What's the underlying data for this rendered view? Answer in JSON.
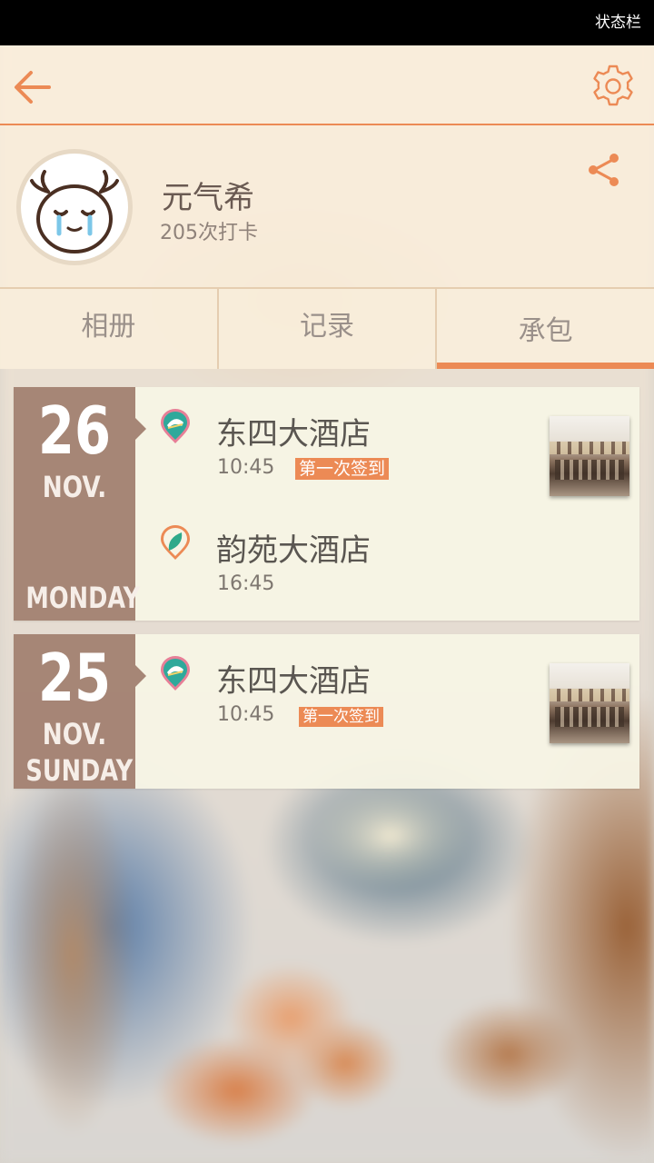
{
  "status_bar": {
    "text": "状态栏"
  },
  "header": {
    "back_icon": "arrow-left-icon",
    "settings_icon": "gear-icon",
    "accent_color": "#ec8a55"
  },
  "profile": {
    "name": "元气希",
    "checkin_count": "205次打卡",
    "share_icon": "share-icon"
  },
  "tabs": [
    {
      "label": "相册",
      "active": false
    },
    {
      "label": "记录",
      "active": false
    },
    {
      "label": "承包",
      "active": true
    }
  ],
  "days": [
    {
      "day": "26",
      "month": "NOV.",
      "weekday": "MONDAY",
      "entries": [
        {
          "hotel": "东四大酒店",
          "time": "10:45",
          "badge": "第一次签到",
          "icon": "sandwich-pin-icon",
          "has_thumb": true
        },
        {
          "hotel": "韵苑大酒店",
          "time": "16:45",
          "badge": "",
          "icon": "leaf-pin-icon",
          "has_thumb": false
        }
      ]
    },
    {
      "day": "25",
      "month": "NOV.",
      "weekday": "SUNDAY",
      "entries": [
        {
          "hotel": "东四大酒店",
          "time": "10:45",
          "badge": "第一次签到",
          "icon": "sandwich-pin-icon",
          "has_thumb": true
        }
      ]
    }
  ]
}
